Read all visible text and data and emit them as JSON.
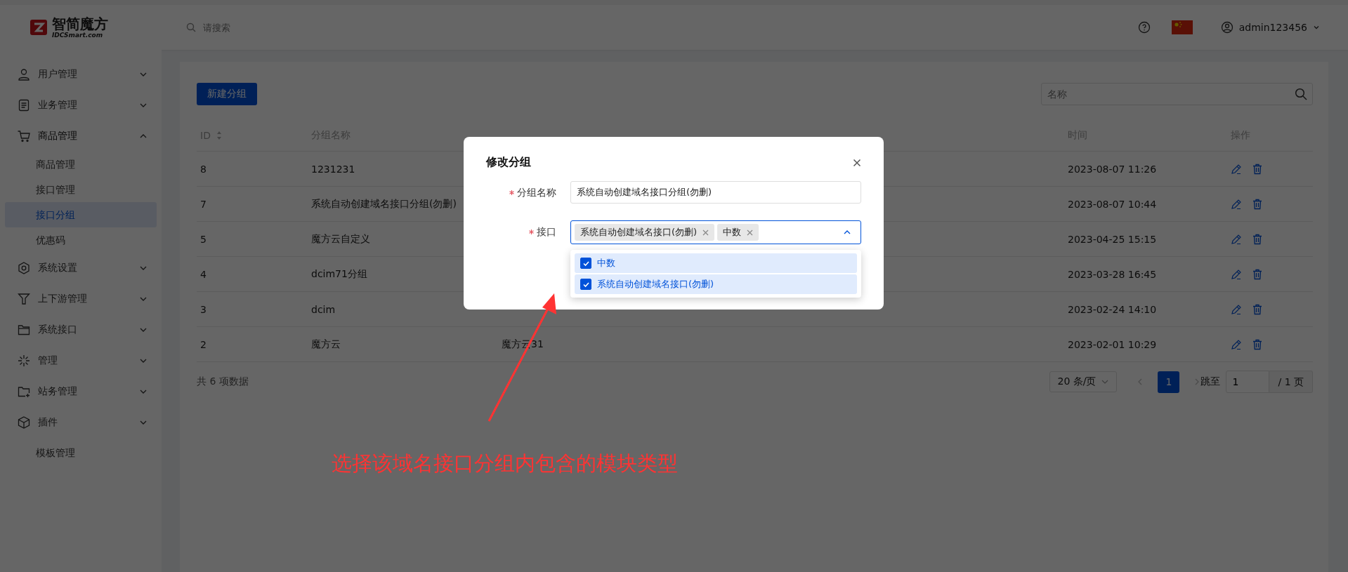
{
  "header": {
    "logo": {
      "name": "智简魔方",
      "sub": "IDCSmart.com"
    },
    "search": {
      "placeholder": "请搜索"
    },
    "user": "admin123456"
  },
  "sidebar": {
    "items": [
      {
        "label": "用户管理",
        "kind": "user",
        "expanded": false
      },
      {
        "label": "业务管理",
        "kind": "document",
        "expanded": false
      },
      {
        "label": "商品管理",
        "kind": "cart",
        "expanded": true,
        "children": [
          {
            "label": "商品管理",
            "selected": false
          },
          {
            "label": "接口管理",
            "selected": false
          },
          {
            "label": "接口分组",
            "selected": true
          },
          {
            "label": "优惠码",
            "selected": false
          }
        ]
      },
      {
        "label": "系统设置",
        "kind": "hexagon",
        "expanded": false
      },
      {
        "label": "上下游管理",
        "kind": "filter",
        "expanded": false
      },
      {
        "label": "系统接口",
        "kind": "folder",
        "expanded": false
      },
      {
        "label": "管理",
        "kind": "sparkle",
        "expanded": false
      },
      {
        "label": "站务管理",
        "kind": "folder-plus",
        "expanded": false
      },
      {
        "label": "插件",
        "kind": "cube",
        "expanded": false
      },
      {
        "label": "模板管理",
        "kind": "plain"
      }
    ]
  },
  "toolbar": {
    "new_button": "新建分组",
    "search": {
      "placeholder": "名称"
    }
  },
  "table": {
    "columns": [
      "ID",
      "分组名称",
      "时间",
      "操作"
    ],
    "rows": [
      {
        "id": "8",
        "name": "1231231",
        "time": "2023-08-07 11:26"
      },
      {
        "id": "7",
        "name": "系统自动创建域名接口分组(勿删)",
        "time": "2023-08-07 10:44"
      },
      {
        "id": "5",
        "name": "魔方云自定义",
        "time": "2023-04-25 15:15"
      },
      {
        "id": "4",
        "name": "dcim71分组",
        "time": "2023-03-28 16:45"
      },
      {
        "id": "3",
        "name": "dcim",
        "time": "2023-02-24 14:10"
      },
      {
        "id": "2",
        "name": "魔方云",
        "interfaces": "魔方云31",
        "time": "2023-02-01 10:29"
      }
    ]
  },
  "pagination": {
    "total": "共 6 项数据",
    "page_size": "20 条/页",
    "pages": [
      {
        "label": "1",
        "selected": true
      }
    ],
    "jump_label": "跳至",
    "jump_value": "1",
    "total_pages": "/ 1 页"
  },
  "modal": {
    "title": "修改分组",
    "fields": [
      {
        "kind": "text",
        "label": "分组名称",
        "required": true,
        "value": "系统自动创建域名接口分组(勿删)"
      },
      {
        "kind": "multiselect",
        "label": "接口",
        "required": true,
        "expanded": true,
        "tags": [
          "系统自动创建域名接口(勿删)",
          "中数"
        ],
        "options": [
          {
            "label": "中数",
            "checked": true
          },
          {
            "label": "系统自动创建域名接口(勿删)",
            "checked": true
          }
        ]
      }
    ]
  },
  "annotation": "选择该域名接口分组内包含的模块类型"
}
